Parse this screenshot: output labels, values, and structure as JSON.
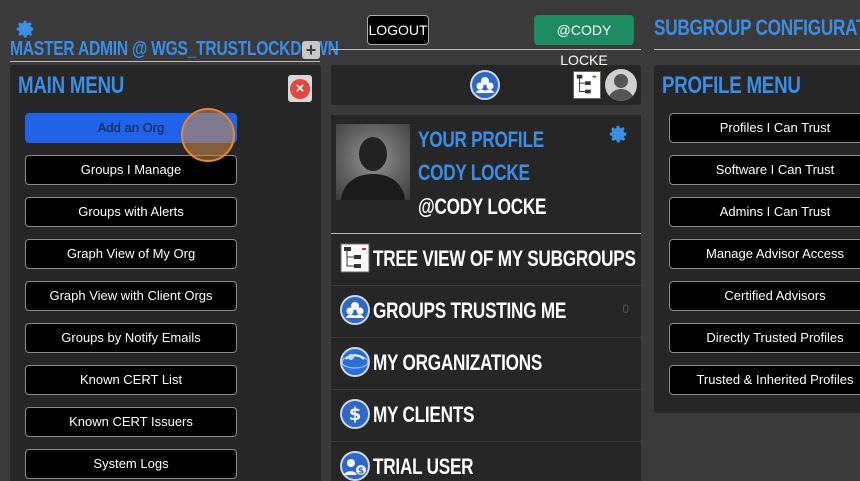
{
  "header": {
    "master_title": "MASTER ADMIN @ WGS_TRUSTLOCKDOWN",
    "plus_label": "+",
    "logout_label": "LOGOUT",
    "user_badge": "@CODY LOCKE",
    "subgroup_title": "SUBGROUP CONFIGURATION"
  },
  "main_menu": {
    "title": "MAIN MENU",
    "close_label": "×",
    "items": [
      {
        "label": "Add an Org"
      },
      {
        "label": "Groups I Manage"
      },
      {
        "label": "Groups with Alerts"
      },
      {
        "label": "Graph View of My Org"
      },
      {
        "label": "Graph View with Client Orgs"
      },
      {
        "label": "Groups by Notify Emails"
      },
      {
        "label": "Known CERT List"
      },
      {
        "label": "Known CERT Issuers"
      },
      {
        "label": "System Logs"
      }
    ]
  },
  "profile": {
    "label": "YOUR PROFILE",
    "name": "CODY LOCKE",
    "handle": "@CODY LOCKE"
  },
  "middle_menu": {
    "items": [
      {
        "label": "TREE VIEW OF MY SUBGROUPS",
        "icon": "tree-view-icon",
        "count": ""
      },
      {
        "label": "GROUPS TRUSTING ME",
        "icon": "groups-icon",
        "count": "0"
      },
      {
        "label": "MY ORGANIZATIONS",
        "icon": "globe-icon",
        "count": ""
      },
      {
        "label": "MY CLIENTS",
        "icon": "dollar-icon",
        "count": ""
      },
      {
        "label": "TRIAL USER",
        "icon": "trial-user-icon",
        "count": ""
      }
    ]
  },
  "profile_menu": {
    "title": "PROFILE MENU",
    "items": [
      {
        "label": "Profiles I Can Trust"
      },
      {
        "label": "Software I Can Trust"
      },
      {
        "label": "Admins I Can Trust"
      },
      {
        "label": "Manage Advisor Access"
      },
      {
        "label": "Certified Advisors"
      },
      {
        "label": "Directly Trusted Profiles"
      },
      {
        "label": "Trusted & Inherited Profiles"
      }
    ]
  },
  "colors": {
    "accent": "#3a8ee6",
    "active_button": "#1f63e9",
    "user_badge": "#1d8a64",
    "panel": "#262626",
    "background": "#3a3a3a"
  }
}
